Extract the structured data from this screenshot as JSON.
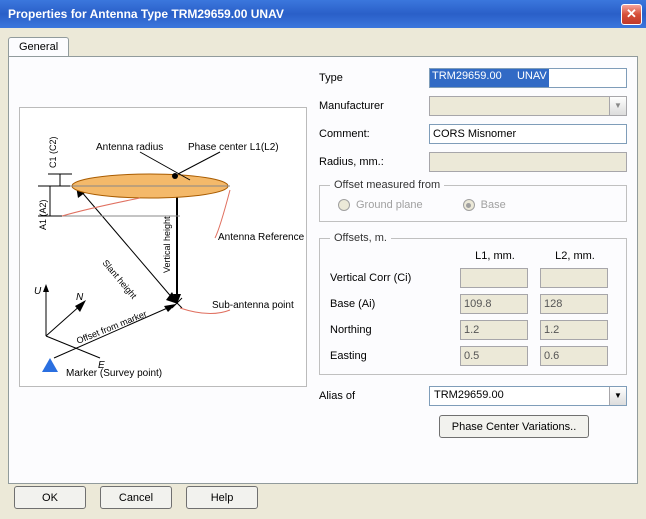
{
  "window": {
    "title": "Properties for Antenna Type TRM29659.00     UNAV"
  },
  "tabs": {
    "general": "General"
  },
  "form": {
    "type_label": "Type",
    "type_value_hl": "TRM29659.00     UNAV",
    "type_value_rest": "",
    "manufacturer_label": "Manufacturer",
    "manufacturer_value": "",
    "comment_label": "Comment:",
    "comment_value": "CORS Misnomer",
    "radius_label": "Radius, mm.:",
    "radius_value": ""
  },
  "offset_from": {
    "legend": "Offset measured from",
    "ground": "Ground plane",
    "base": "Base"
  },
  "offsets": {
    "legend": "Offsets, m.",
    "col_l1": "L1, mm.",
    "col_l2": "L2, mm.",
    "rows": {
      "vcorr_label": "Vertical Corr (Ci)",
      "vcorr_l1": "",
      "vcorr_l2": "",
      "base_label": "Base (Ai)",
      "base_l1": "109.8",
      "base_l2": "128",
      "northing_label": "Northing",
      "northing_l1": "1.2",
      "northing_l2": "1.2",
      "easting_label": "Easting",
      "easting_l1": "0.5",
      "easting_l2": "0.6"
    }
  },
  "alias": {
    "label": "Alias of",
    "value": "TRM29659.00"
  },
  "buttons": {
    "pcv": "Phase Center Variations..",
    "ok": "OK",
    "cancel": "Cancel",
    "help": "Help"
  },
  "diagram": {
    "antenna_radius": "Antenna radius",
    "phase_center": "Phase center L1(L2)",
    "arp": "Antenna Reference Point  (ARP, Base)",
    "sub_antenna": "Sub-antenna point",
    "marker": "Marker (Survey point)",
    "offset_marker": "Offset from marker",
    "slant": "Slant height",
    "vert": "Vertical height",
    "c1": "C1 (C2)",
    "a1": "A1 (A2)",
    "U": "U",
    "N": "N",
    "E": "E"
  }
}
